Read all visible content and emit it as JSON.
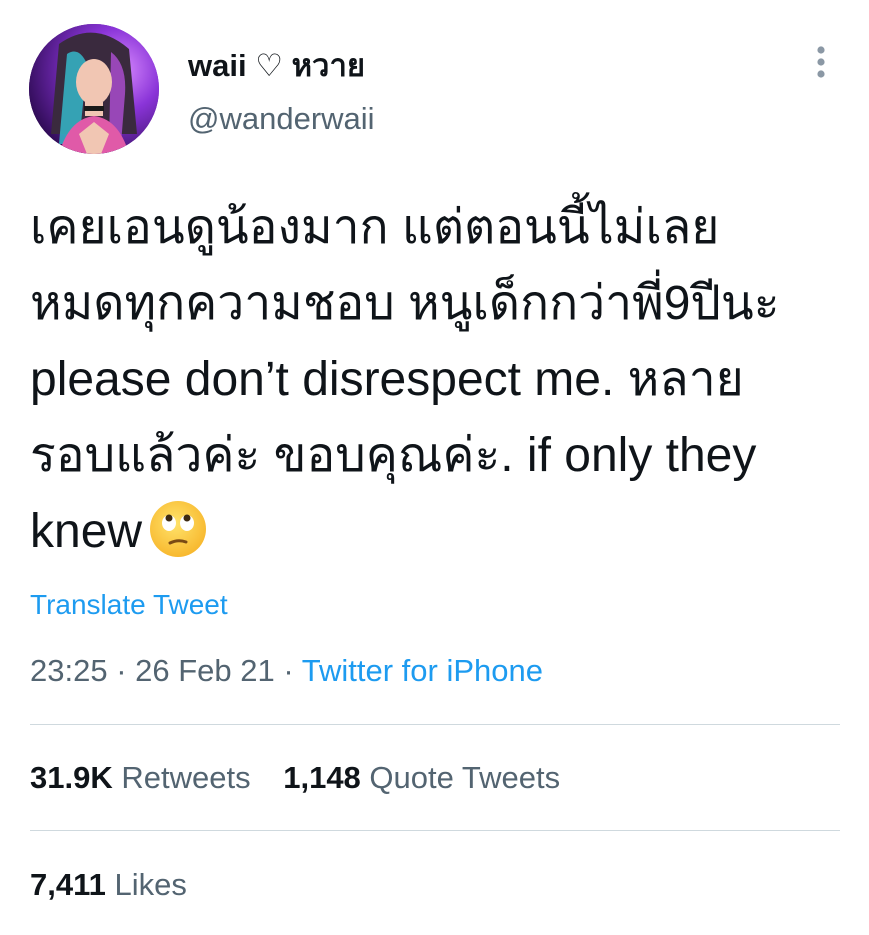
{
  "user": {
    "display_name": "waii ♡ หวาย",
    "handle": "@wanderwaii"
  },
  "tweet": {
    "lines": [
      "เคยเอนดูน้องมาก แต่ตอนนี้ไม่เลย",
      "หมดทุกความชอบ หนูเด็กกว่าพี่9ปีนะ",
      "please don’t disrespect me. หลาย",
      "รอบแล้วค่ะ ขอบคุณค่ะ. if only they",
      "knew"
    ],
    "emoji": "face-with-rolling-eyes"
  },
  "translate_label": "Translate Tweet",
  "meta": {
    "time": "23:25",
    "separator": "·",
    "date": "26 Feb 21",
    "source": "Twitter for iPhone"
  },
  "stats": {
    "retweets_count": "31.9K",
    "retweets_label": "Retweets",
    "quotes_count": "1,148",
    "quotes_label": "Quote Tweets",
    "likes_count": "7,411",
    "likes_label": "Likes"
  },
  "icons": {
    "more": "more-vertical-icon",
    "emoji": "rolling-eyes-emoji"
  },
  "colors": {
    "link": "#1d9bf0",
    "secondary": "#536471",
    "primary": "#0f1419",
    "divider": "#cfd9de"
  }
}
